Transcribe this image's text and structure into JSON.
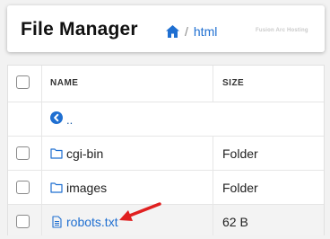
{
  "header": {
    "title": "File Manager",
    "breadcrumb_path": "html",
    "breadcrumb_separator": "/",
    "brand": "Fusion Arc Hosting"
  },
  "table": {
    "columns": {
      "name": "NAME",
      "size": "SIZE"
    },
    "parent_label": "..",
    "rows": [
      {
        "name": "cgi-bin",
        "type": "folder",
        "size": "Folder"
      },
      {
        "name": "images",
        "type": "folder",
        "size": "Folder"
      },
      {
        "name": "robots.txt",
        "type": "file",
        "size": "62 B"
      }
    ]
  },
  "colors": {
    "link": "#1f6fd1",
    "arrow": "#e02020",
    "highlight_row": "#f3f3f3"
  },
  "icons": [
    "home-icon",
    "back-circle-icon",
    "folder-icon",
    "text-file-icon",
    "red-arrow-annotation"
  ]
}
